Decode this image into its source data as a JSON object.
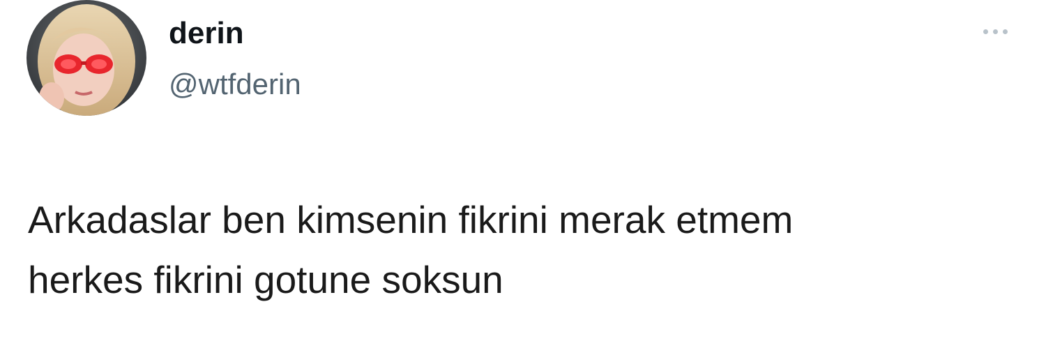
{
  "tweet": {
    "author": {
      "display_name": "derin",
      "handle": "@wtfderin",
      "avatar_icon": "profile-photo"
    },
    "more_icon": "more-horizontal-icon",
    "text_lines": [
      "Arkadaslar ben kimsenin fikrini merak etmem",
      "herkes fikrini gotune soksun"
    ]
  },
  "colors": {
    "background": "#ffffff",
    "name": "#0f1419",
    "handle": "#536471",
    "text": "#1a1a1a",
    "more_dots": "#b8c2ca"
  }
}
